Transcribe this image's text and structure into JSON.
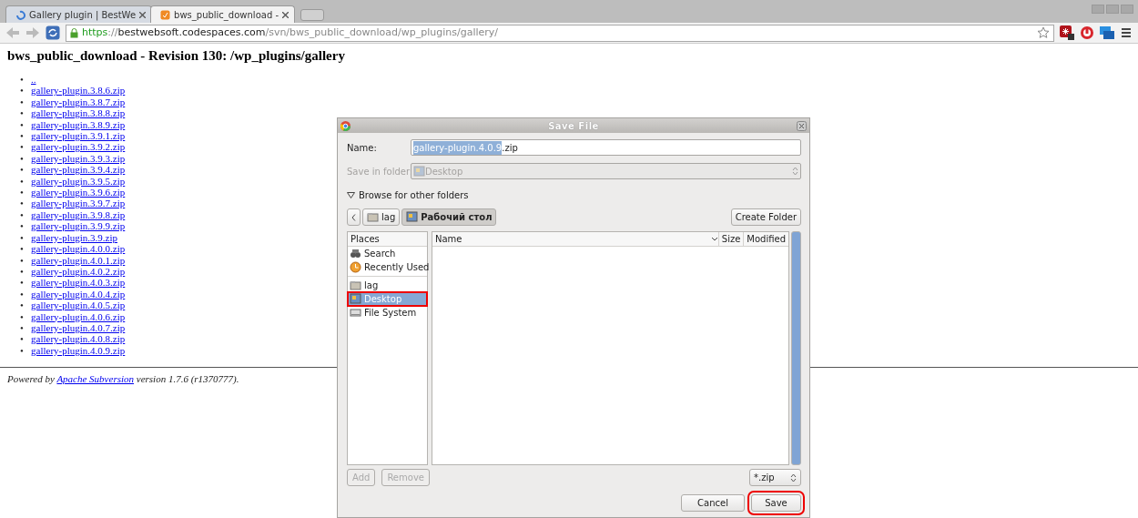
{
  "browser": {
    "tabs": [
      {
        "title": "Gallery plugin | BestWe",
        "selected": false
      },
      {
        "title": "bws_public_download -",
        "selected": true
      }
    ],
    "address": {
      "scheme": "https",
      "separator": "://",
      "host": "bestwebsoft.codespaces.com",
      "path": "/svn/bws_public_download/wp_plugins/gallery/"
    }
  },
  "page": {
    "heading": "bws_public_download - Revision 130: /wp_plugins/gallery",
    "marker": "•",
    "links": [
      "..",
      "gallery-plugin.3.8.6.zip",
      "gallery-plugin.3.8.7.zip",
      "gallery-plugin.3.8.8.zip",
      "gallery-plugin.3.8.9.zip",
      "gallery-plugin.3.9.1.zip",
      "gallery-plugin.3.9.2.zip",
      "gallery-plugin.3.9.3.zip",
      "gallery-plugin.3.9.4.zip",
      "gallery-plugin.3.9.5.zip",
      "gallery-plugin.3.9.6.zip",
      "gallery-plugin.3.9.7.zip",
      "gallery-plugin.3.9.8.zip",
      "gallery-plugin.3.9.9.zip",
      "gallery-plugin.3.9.zip",
      "gallery-plugin.4.0.0.zip",
      "gallery-plugin.4.0.1.zip",
      "gallery-plugin.4.0.2.zip",
      "gallery-plugin.4.0.3.zip",
      "gallery-plugin.4.0.4.zip",
      "gallery-plugin.4.0.5.zip",
      "gallery-plugin.4.0.6.zip",
      "gallery-plugin.4.0.7.zip",
      "gallery-plugin.4.0.8.zip",
      "gallery-plugin.4.0.9.zip"
    ],
    "footer": {
      "before": "Powered by ",
      "link": "Apache Subversion",
      "after": " version 1.7.6 (r1370777)."
    }
  },
  "dialog": {
    "title": "Save File",
    "name_field": {
      "label": "Name:",
      "selected_text": "gallery-plugin.4.0.9",
      "rest_text": ".zip"
    },
    "folder_field": {
      "label": "Save in folder:",
      "value": "Desktop",
      "disabled": true
    },
    "browse_toggle": {
      "label": "Browse for other folders",
      "expanded": true
    },
    "path_bar": [
      {
        "label": "lag",
        "kind": "folder",
        "selected": false
      },
      {
        "label": "Рабочий стол",
        "kind": "desktop",
        "selected": true
      }
    ],
    "create_folder": "Create Folder",
    "places_header": "Places",
    "places": [
      {
        "label": "Search",
        "kind": "search",
        "selected": false,
        "highlighted": false
      },
      {
        "label": "Recently Used",
        "kind": "recent",
        "selected": false,
        "highlighted": false
      },
      {
        "label": "lag",
        "kind": "folder",
        "selected": false,
        "highlighted": false,
        "separator_before": true
      },
      {
        "label": "Desktop",
        "kind": "desktop",
        "selected": true,
        "highlighted": true
      },
      {
        "label": "File System",
        "kind": "drive",
        "selected": false,
        "highlighted": false
      }
    ],
    "columns": [
      "Name",
      "Size",
      "Modified"
    ],
    "add_button": {
      "label": "Add",
      "disabled": true
    },
    "remove_button": {
      "label": "Remove",
      "disabled": true
    },
    "filter": "*.zip",
    "cancel_button": {
      "label": "Cancel",
      "highlighted": false
    },
    "save_button": {
      "label": "Save",
      "highlighted": true
    }
  }
}
